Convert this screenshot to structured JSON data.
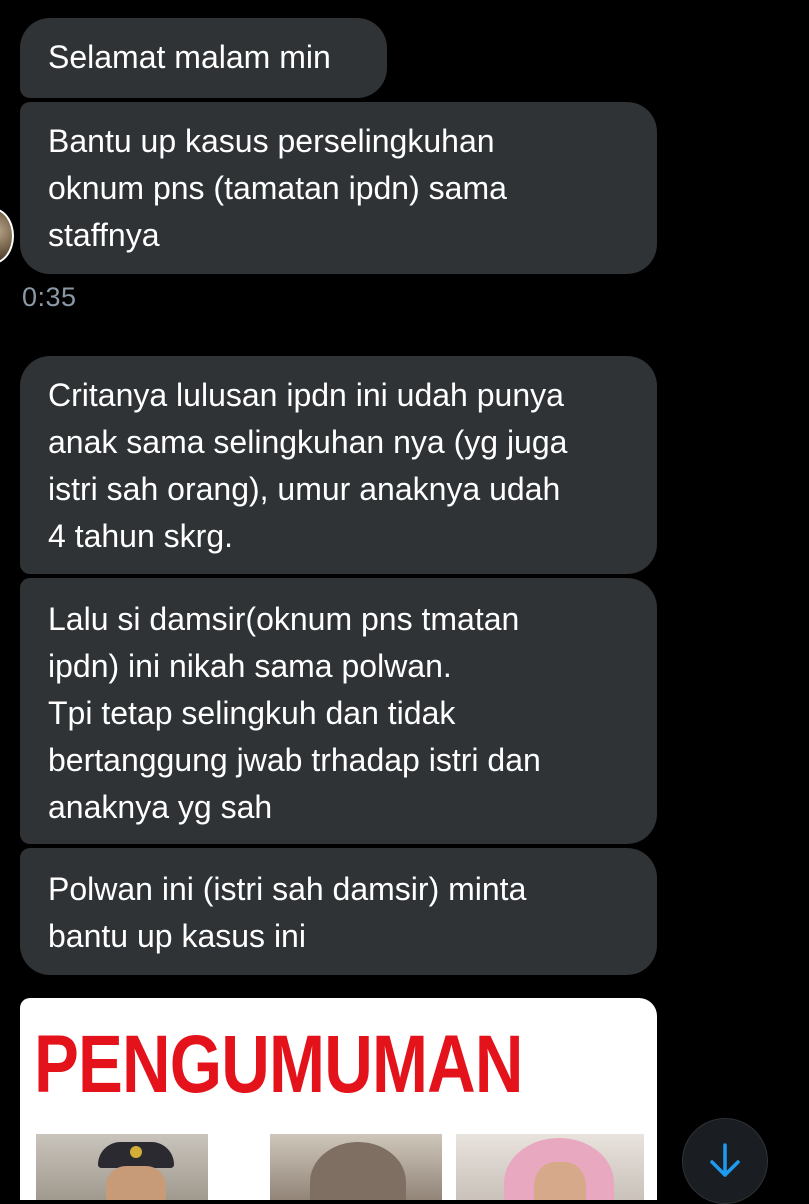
{
  "conversation": {
    "messages": [
      {
        "text": "Selamat malam min"
      },
      {
        "text": "Bantu up kasus perselingkuhan\noknum pns (tamatan ipdn) sama\nstaffnya"
      },
      {
        "text": "Critanya lulusan ipdn ini udah punya\nanak sama selingkuhan nya (yg juga\nistri sah orang), umur anaknya udah\n4 tahun skrg."
      },
      {
        "text": "Lalu si damsir(oknum pns tmatan\nipdn) ini nikah sama polwan.\nTpi tetap selingkuh dan tidak\nbertanggung jwab trhadap istri dan\nanaknya yg sah"
      },
      {
        "text": "Polwan ini (istri sah damsir) minta\nbantu up kasus ini"
      }
    ],
    "timestamp": "0:35",
    "attachment": {
      "headline": "PENGUMUMAN"
    }
  },
  "controls": {
    "scroll_down_icon": "arrow-down-icon"
  },
  "colors": {
    "background": "#000000",
    "bubble": "#2f3336",
    "timestamp": "#8b98a5",
    "headline": "#e4131b",
    "accent": "#1d9bf0"
  }
}
